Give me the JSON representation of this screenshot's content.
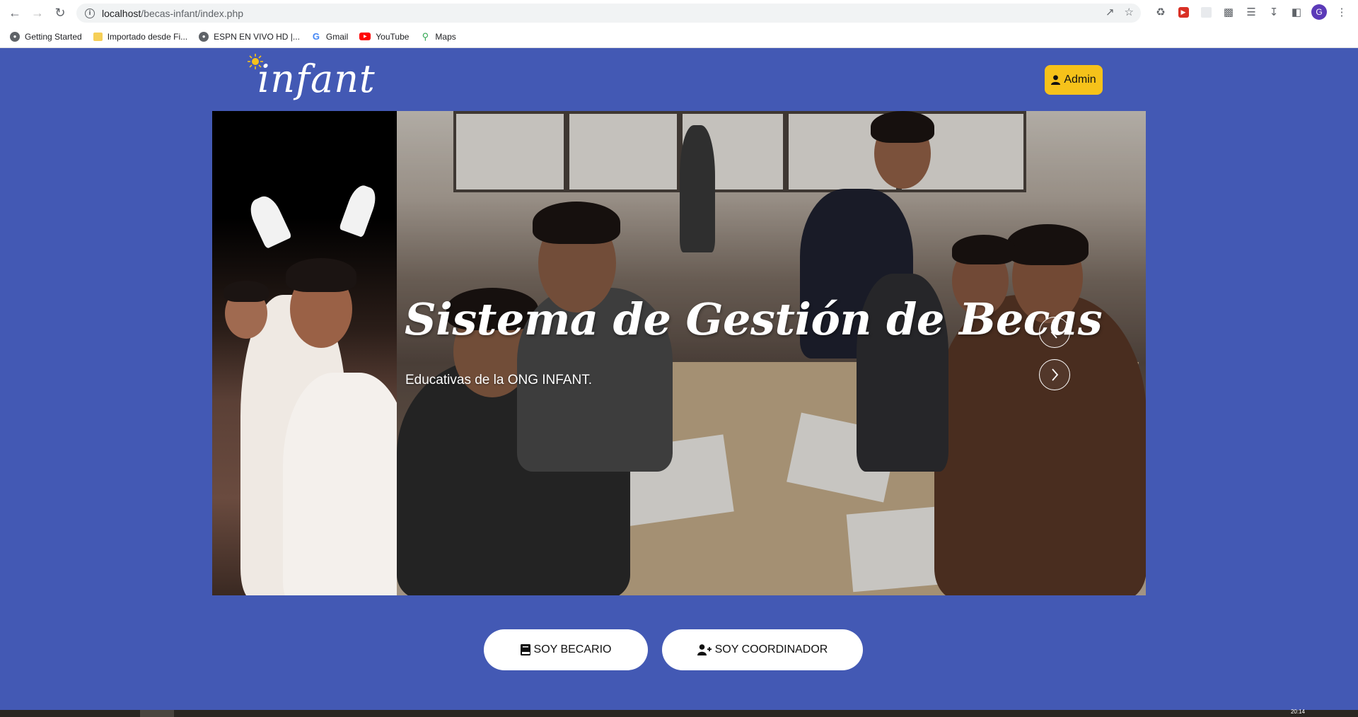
{
  "browser": {
    "url_host": "localhost",
    "url_path": "/becas-infant/index.php",
    "profile_initial": "G"
  },
  "bookmarks": [
    {
      "label": "Getting Started",
      "icon": "globe-icon"
    },
    {
      "label": "Importado desde Fi...",
      "icon": "folder-icon"
    },
    {
      "label": "ESPN EN VIVO HD |...",
      "icon": "globe-icon"
    },
    {
      "label": "Gmail",
      "icon": "google-icon"
    },
    {
      "label": "YouTube",
      "icon": "youtube-icon"
    },
    {
      "label": "Maps",
      "icon": "maps-pin-icon"
    }
  ],
  "header": {
    "logo_text": "infant",
    "admin_label": "Admin"
  },
  "hero": {
    "title": "Sistema de Gestión de Becas",
    "subtitle": "Educativas de la ONG INFANT."
  },
  "actions": {
    "becario_label": "SOY BECARIO",
    "coordinador_label": "SOY COORDINADOR"
  },
  "taskbar": {
    "clock": "20:14"
  },
  "colors": {
    "page_bg": "#4359b4",
    "admin_bg": "#f6c21a",
    "button_bg": "#ffffff"
  }
}
